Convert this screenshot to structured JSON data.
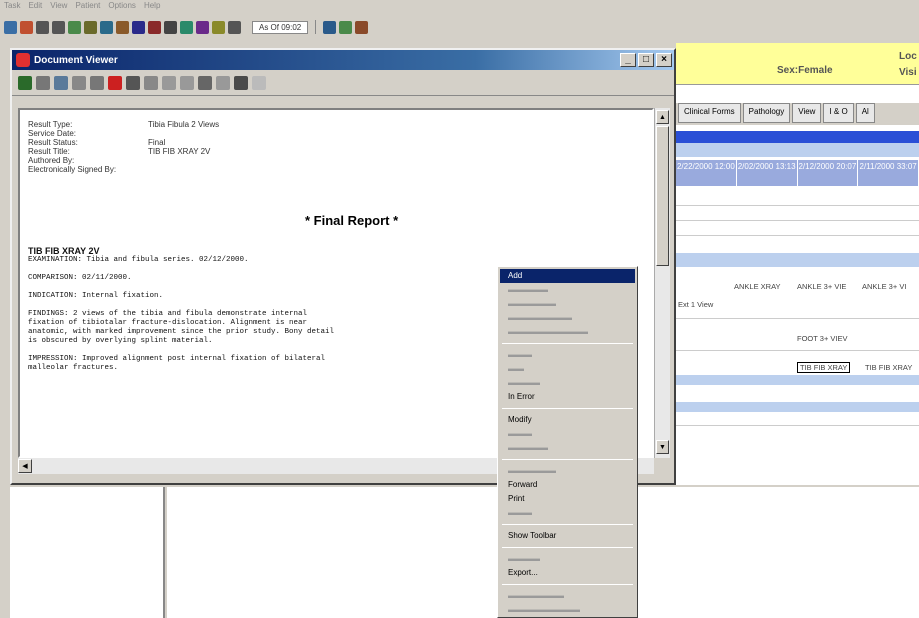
{
  "menubar": {
    "items": [
      "Task",
      "Edit",
      "View",
      "Patient",
      "Options",
      "Help"
    ]
  },
  "toolbar": {
    "time_box": "As Of 09:02"
  },
  "background_app": {
    "patient_sex": "Sex:Female",
    "loc_label": "Loc",
    "visit_label": "Visi",
    "tabs": [
      "Clinical Forms",
      "Pathology",
      "View",
      "I & O",
      "Al"
    ],
    "dates": [
      "2/22/2000 12:00",
      "2/02/2000 13:13",
      "2/12/2000 20:07",
      "2/11/2000 33:07"
    ],
    "cells": {
      "ankle_1": "ANKLE XRAY",
      "ankle_2": "ANKLE 3+ VIE",
      "ankle_3": "ANKLE 3+ VI",
      "row_label": "Ext 1 View",
      "foot": "FOOT 3+ VIEV",
      "tibfib_1": "TIB FIB XRAY",
      "tibfib_2": "TIB FIB XRAY"
    }
  },
  "doc_window": {
    "title": "Document Viewer",
    "buttons": {
      "minimize": "_",
      "maximize": "□",
      "close": "×"
    },
    "meta": {
      "result_type_label": "Result Type:",
      "result_type_value": "Tibia Fibula 2 Views",
      "service_date_label": "Service Date:",
      "result_status_label": "Result Status:",
      "result_status_value": "Final",
      "result_title_label": "Result Title:",
      "result_title_value": "TIB FIB XRAY 2V",
      "authored_label": "Authored By:",
      "signed_label": "Electronically Signed By:"
    },
    "report_title": "* Final Report *",
    "report": {
      "header": "TIB FIB XRAY 2V",
      "examination": "EXAMINATION: Tibia and fibula series. 02/12/2000.",
      "comparison": "COMPARISON: 02/11/2000.",
      "indication": "INDICATION: Internal fixation.",
      "findings": "FINDINGS: 2 views of the tibia and fibula demonstrate internal\nfixation of tibiotalar fracture-dislocation. Alignment is near\nanatomic, with marked improvement since the prior study. Bony detail\nis obscured by overlying splint material.",
      "impression": "IMPRESSION: Improved alignment post internal fixation of bilateral\nmalleolar fractures."
    }
  },
  "context_menu": {
    "items": [
      {
        "label": "Add",
        "state": "selected"
      },
      {
        "label": "Forward",
        "state": "normal"
      },
      {
        "label": "Print",
        "state": "normal"
      },
      {
        "label": "Show Toolbar",
        "state": "normal"
      },
      {
        "label": "Export...",
        "state": "normal"
      },
      {
        "label": "In Error",
        "state": "normal"
      },
      {
        "label": "Modify",
        "state": "normal"
      }
    ]
  }
}
